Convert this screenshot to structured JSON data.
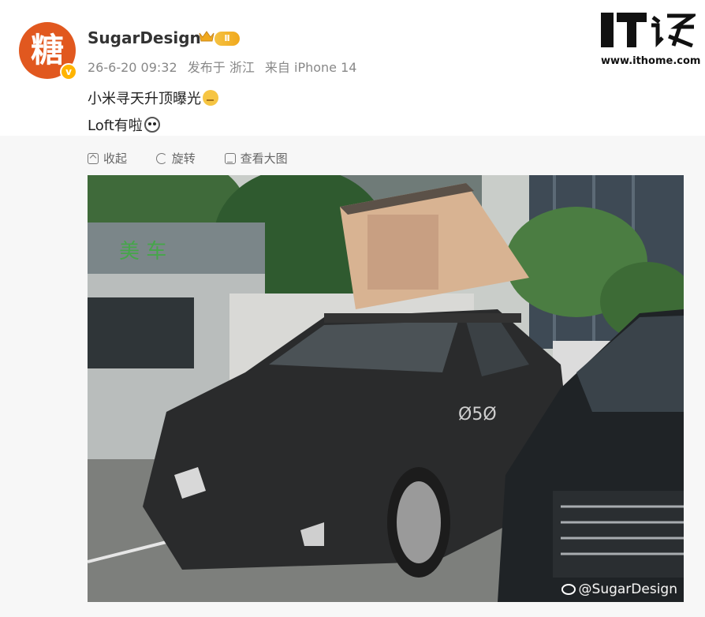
{
  "post": {
    "author": {
      "name": "SugarDesign",
      "avatar_char": "糖",
      "verified_mark": "v",
      "level": "Ⅱ"
    },
    "meta": {
      "time": "26-6-20 09:32",
      "location": "发布于 浙江",
      "source": "来自 iPhone 14"
    },
    "text_line_1": "小米寻天升顶曝光",
    "text_line_2": "Loft有啦"
  },
  "toolbar": {
    "collapse_label": "收起",
    "rotate_label": "旋转",
    "view_large_label": "查看大图"
  },
  "photo": {
    "sign_text": "美 车",
    "plate_text": "Ø5Ø",
    "watermark": "@SugarDesign"
  },
  "site": {
    "logo": "IT之家",
    "url": "www.ithome.com"
  },
  "colors": {
    "avatar_bg": "#e1581f",
    "badge": "#ffb400",
    "meta_text": "#888888",
    "toolbar_bg": "#f7f7f7"
  }
}
